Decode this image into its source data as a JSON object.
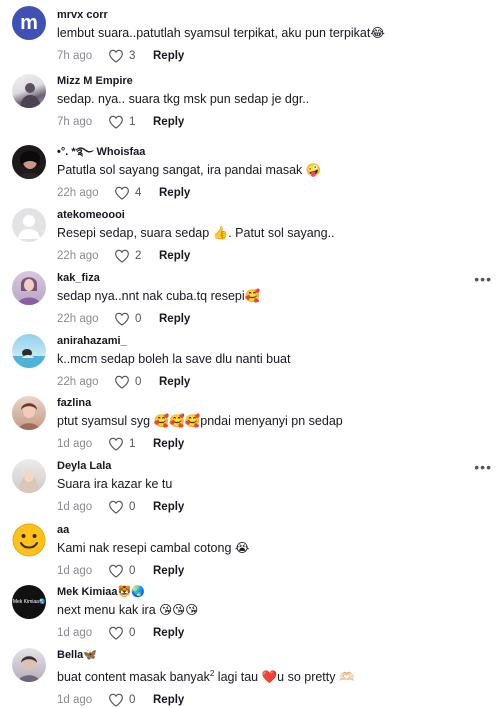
{
  "comments": [
    {
      "username": "mrvx corr",
      "text": "lembut suara..patutlah syamsul terpikat, aku pun terpikat😂",
      "time": "7h ago",
      "likes": "3",
      "reply": "Reply",
      "avatar_letter": "m"
    },
    {
      "username": "Mizz M Empire",
      "text": "sedap. nya.. suara tkg msk pun sedap je dgr..",
      "time": "7h ago",
      "likes": "1",
      "reply": "Reply"
    },
    {
      "username": "•°. *࿐ Whoisfaa",
      "text": "Patutla sol sayang sangat, ira pandai masak 🤪",
      "time": "22h ago",
      "likes": "4",
      "reply": "Reply"
    },
    {
      "username": "atekomeoooi",
      "text": "Resepi sedap, suara sedap 👍. Patut sol sayang..",
      "time": "22h ago",
      "likes": "2",
      "reply": "Reply"
    },
    {
      "username": "kak_fiza",
      "text": "sedap nya..nnt nak cuba.tq resepi🥰",
      "time": "22h ago",
      "likes": "0",
      "reply": "Reply"
    },
    {
      "username": "anirahazami_",
      "text": "k..mcm sedap boleh la save dlu nanti buat",
      "time": "22h ago",
      "likes": "0",
      "reply": "Reply"
    },
    {
      "username": "fazlina",
      "text": "ptut syamsul syg 🥰🥰🥰pndai menyanyi pn sedap",
      "time": "1d ago",
      "likes": "1",
      "reply": "Reply"
    },
    {
      "username": "Deyla Lala",
      "text": "Suara ira kazar ke tu",
      "time": "1d ago",
      "likes": "0",
      "reply": "Reply"
    },
    {
      "username": "aa",
      "text": "Kami nak resepi cambal cotong 😭",
      "time": "1d ago",
      "likes": "0",
      "reply": "Reply"
    },
    {
      "username": "Mek Kimiaa🐯🌏",
      "text": "next menu kak ira 😘😘😘",
      "time": "1d ago",
      "likes": "0",
      "reply": "Reply",
      "avatar_text": "Mek Kimiaa🌏"
    },
    {
      "username": "Bella🦋",
      "text_before": "buat content masak banyak",
      "text_sup": "2",
      "text_after": " lagi tau ❤️u so pretty 🫶🏻",
      "time": "1d ago",
      "likes": "0",
      "reply": "Reply"
    }
  ],
  "more_icon": "more-dots-icon",
  "like_icon": "heart-outline-icon",
  "colors": {
    "accent_blue": "#3f51b5",
    "muted": "#8a8b91",
    "text": "#161823"
  }
}
